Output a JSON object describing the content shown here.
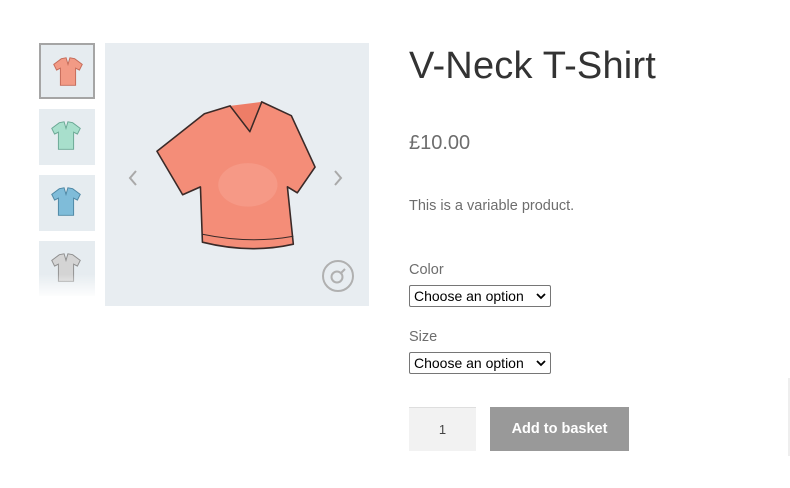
{
  "gallery": {
    "thumbnails": [
      {
        "name": "coral t-shirt",
        "color": "#f29a85",
        "active": true
      },
      {
        "name": "mint t-shirt",
        "color": "#a8dfcc",
        "active": false
      },
      {
        "name": "blue t-shirt",
        "color": "#7fbcd9",
        "active": false
      },
      {
        "name": "grey t-shirt",
        "color": "#d4d4d4",
        "active": false
      }
    ],
    "main_color": "#f48d78",
    "prev_icon": "chevron-left-icon",
    "next_icon": "chevron-right-icon",
    "zoom_icon": "magnify-icon"
  },
  "product": {
    "title": "V-Neck T-Shirt",
    "price": "£10.00",
    "description": "This is a variable product."
  },
  "variations": {
    "color_label": "Color",
    "color_value": "Choose an option",
    "size_label": "Size",
    "size_value": "Choose an option"
  },
  "cart": {
    "quantity": "1",
    "add_label": "Add to basket",
    "button_color": "#999999"
  }
}
